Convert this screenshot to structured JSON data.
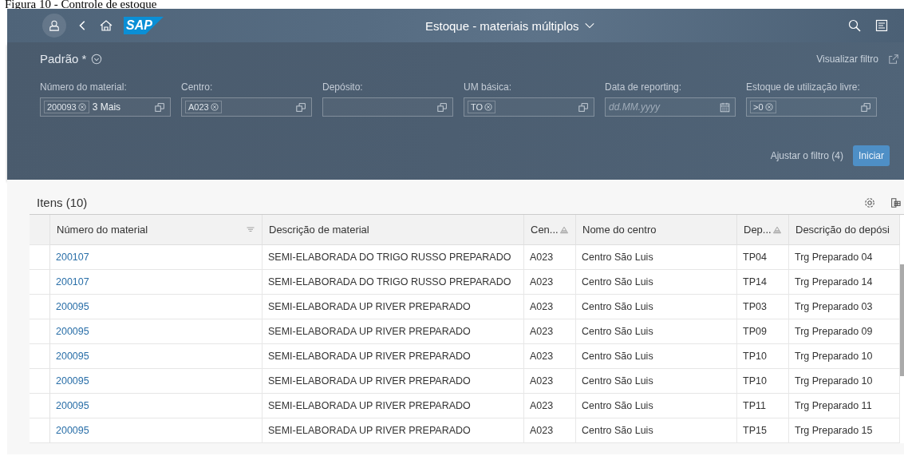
{
  "caption": "Figura 10 - Controle de estoque",
  "shell": {
    "title": "Estoque - materiais múltiplos",
    "logo": "SAP"
  },
  "filter_bar": {
    "variant": "Padrão *",
    "show_filter": "Visualizar filtro",
    "fields": [
      {
        "label": "Número do material:",
        "tokens": [
          "200093"
        ],
        "text": "3 Mais",
        "kind": "valuehelp"
      },
      {
        "label": "Centro:",
        "tokens": [
          "A023"
        ],
        "kind": "valuehelp"
      },
      {
        "label": "Depósito:",
        "kind": "valuehelp"
      },
      {
        "label": "UM básica:",
        "tokens": [
          "TO"
        ],
        "kind": "valuehelp"
      },
      {
        "label": "Data de reporting:",
        "placeholder": "dd.MM.yyyy",
        "kind": "date"
      },
      {
        "label": "Estoque de utilização livre:",
        "tokens": [
          ">0"
        ],
        "kind": "valuehelp"
      }
    ],
    "adapt": "Ajustar o filtro (4)",
    "go": "Iniciar"
  },
  "table": {
    "title": "Itens (10)",
    "columns": [
      {
        "label": "Número do material",
        "filtered": true,
        "sorted": false
      },
      {
        "label": "Descrição de material",
        "filtered": false,
        "sorted": false
      },
      {
        "label": "Cen...",
        "filtered": false,
        "sorted": true
      },
      {
        "label": "Nome do centro",
        "filtered": false,
        "sorted": false
      },
      {
        "label": "Dep...",
        "filtered": false,
        "sorted": true
      },
      {
        "label": "Descrição do depósi",
        "filtered": false,
        "sorted": false
      }
    ],
    "rows": [
      [
        "200107",
        "SEMI-ELABORADA DO TRIGO RUSSO PREPARADO",
        "A023",
        "Centro São Luis",
        "TP04",
        "Trg Preparado 04"
      ],
      [
        "200107",
        "SEMI-ELABORADA DO TRIGO RUSSO PREPARADO",
        "A023",
        "Centro São Luis",
        "TP14",
        "Trg Preparado 14"
      ],
      [
        "200095",
        "SEMI-ELABORADA UP RIVER PREPARADO",
        "A023",
        "Centro São Luis",
        "TP03",
        "Trg Preparado 03"
      ],
      [
        "200095",
        "SEMI-ELABORADA UP RIVER PREPARADO",
        "A023",
        "Centro São Luis",
        "TP09",
        "Trg Preparado 09"
      ],
      [
        "200095",
        "SEMI-ELABORADA UP RIVER PREPARADO",
        "A023",
        "Centro São Luis",
        "TP10",
        "Trg Preparado 10"
      ],
      [
        "200095",
        "SEMI-ELABORADA UP RIVER PREPARADO",
        "A023",
        "Centro São Luis",
        "TP10",
        "Trg Preparado 10"
      ],
      [
        "200095",
        "SEMI-ELABORADA UP RIVER PREPARADO",
        "A023",
        "Centro São Luis",
        "TP11",
        "Trg Preparado 11"
      ],
      [
        "200095",
        "SEMI-ELABORADA UP RIVER PREPARADO",
        "A023",
        "Centro São Luis",
        "TP15",
        "Trg Preparado 15"
      ]
    ]
  }
}
